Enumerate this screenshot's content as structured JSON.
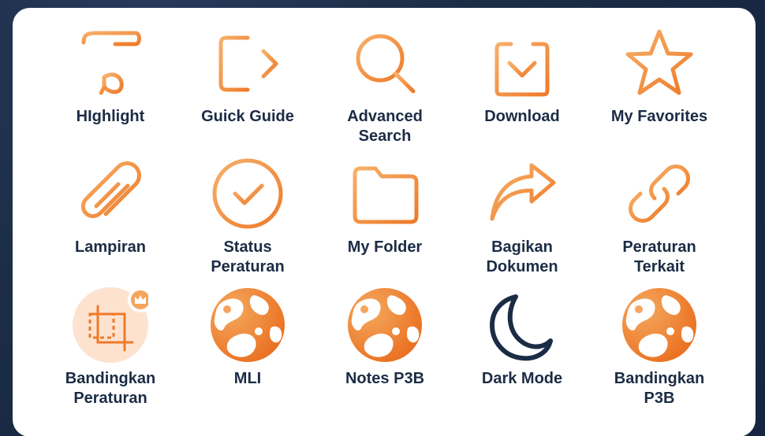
{
  "colors": {
    "accent_light": "#f5a55d",
    "accent_dark": "#ee7a28",
    "navy": "#1b2c45",
    "panel_bg": "#ffffff",
    "badge_bg": "#fde3cf"
  },
  "tiles": [
    {
      "label": "HIghlight",
      "icon": "highlight-pen-icon"
    },
    {
      "label": "Guick Guide",
      "icon": "exit-arrow-icon"
    },
    {
      "label": "Advanced\nSearch",
      "icon": "search-icon"
    },
    {
      "label": "Download",
      "icon": "download-icon"
    },
    {
      "label": "My Favorites",
      "icon": "star-icon"
    },
    {
      "label": "Lampiran",
      "icon": "paperclip-icon"
    },
    {
      "label": "Status\nPeraturan",
      "icon": "check-circle-icon"
    },
    {
      "label": "My Folder",
      "icon": "folder-icon"
    },
    {
      "label": "Bagikan\nDokumen",
      "icon": "share-arrow-icon"
    },
    {
      "label": "Peraturan\nTerkait",
      "icon": "link-icon"
    },
    {
      "label": "Bandingkan\nPeraturan",
      "icon": "compare-crop-icon"
    },
    {
      "label": "MLI",
      "icon": "globe-icon"
    },
    {
      "label": "Notes P3B",
      "icon": "globe-icon"
    },
    {
      "label": "Dark Mode",
      "icon": "moon-icon"
    },
    {
      "label": "Bandingkan\nP3B",
      "icon": "globe-icon"
    }
  ]
}
